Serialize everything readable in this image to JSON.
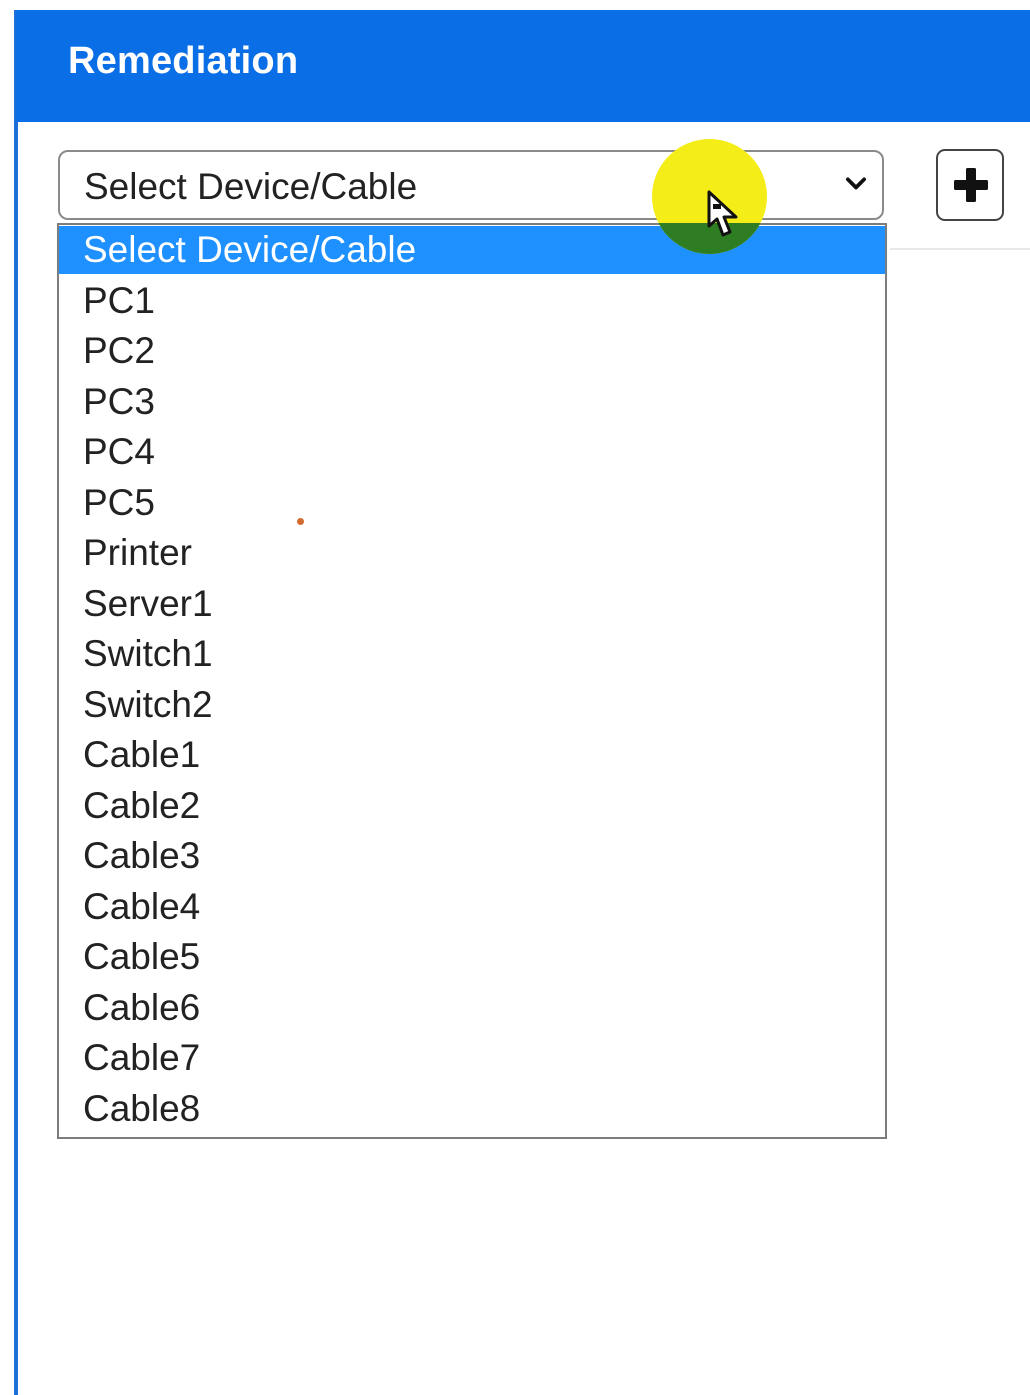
{
  "panel": {
    "title": "Remediation"
  },
  "selector": {
    "selected_value": "Select Device/Cable",
    "options": [
      "Select Device/Cable",
      "PC1",
      "PC2",
      "PC3",
      "PC4",
      "PC5",
      "Printer",
      "Server1",
      "Switch1",
      "Switch2",
      "Cable1",
      "Cable2",
      "Cable3",
      "Cable4",
      "Cable5",
      "Cable6",
      "Cable7",
      "Cable8"
    ]
  },
  "icons": {
    "dropdown": "chevron-down-icon",
    "add": "plus-icon",
    "cursor": "mouse-cursor-icon"
  },
  "colors": {
    "header": "#0a6ee6",
    "selected_option": "#1e90ff",
    "click_highlight": "#f5ed18"
  }
}
